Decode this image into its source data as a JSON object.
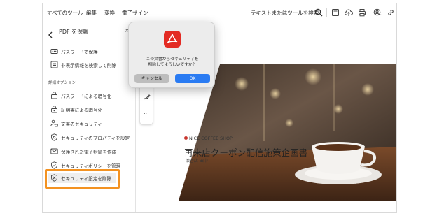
{
  "menubar": {
    "items": [
      "すべてのツール",
      "編集",
      "変換",
      "電子サイン"
    ],
    "search_label": "テキストまたはツールを検索"
  },
  "panel": {
    "title": "PDF を保護",
    "close_glyph": "×",
    "top_items": [
      "パスワードで保護",
      "非表示情報を検索して削除"
    ],
    "section_label": "詳細オプション",
    "advanced_items": [
      "パスワードによる暗号化",
      "証明書による暗号化",
      "文書のセキュリティ",
      "セキュリティのプロパティを設定",
      "保護された電子封筒を作成",
      "セキュリティポリシーを管理",
      "セキュリティ設定を削除"
    ]
  },
  "document": {
    "brand": "NICE COFFEE SHOP",
    "title": "再来店クーポン配信施策企画書",
    "author": "渋谷店 田中",
    "more_glyph": "..."
  },
  "dialog": {
    "message_line1": "この文書からセキュリティを",
    "message_line2": "削除してよろしいですか？",
    "cancel_label": "キャンセル",
    "ok_label": "OK"
  },
  "colors": {
    "accent_blue": "#2a7bf2",
    "acrobat_red": "#e32b23",
    "highlight_orange": "#f39221"
  }
}
